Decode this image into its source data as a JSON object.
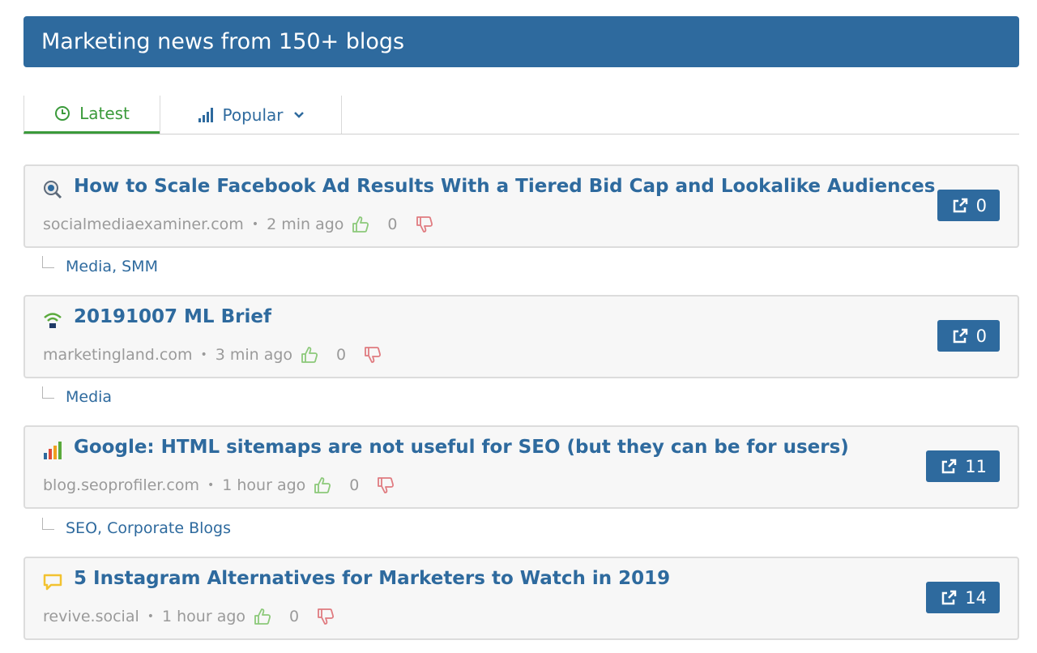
{
  "header": {
    "title": "Marketing news from 150+ blogs"
  },
  "tabs": {
    "latest": "Latest",
    "popular": "Popular"
  },
  "posts": [
    {
      "title": "How to Scale Facebook Ad Results With a Tiered Bid Cap and Lookalike Audiences",
      "source": "socialmediaexaminer.com",
      "time": "2 min ago",
      "votes": "0",
      "shares": "0",
      "tags": [
        "Media",
        "SMM"
      ],
      "icon": "magnifier-icon"
    },
    {
      "title": "20191007 ML Brief",
      "source": "marketingland.com",
      "time": "3 min ago",
      "votes": "0",
      "shares": "0",
      "tags": [
        "Media"
      ],
      "icon": "wifi-icon"
    },
    {
      "title": "Google: HTML sitemaps are not useful for SEO (but they can be for users)",
      "source": "blog.seoprofiler.com",
      "time": "1 hour ago",
      "votes": "0",
      "shares": "11",
      "tags": [
        "SEO",
        "Corporate Blogs"
      ],
      "icon": "bar-chart-icon"
    },
    {
      "title": "5 Instagram Alternatives for Marketers to Watch in 2019",
      "source": "revive.social",
      "time": "1 hour ago",
      "votes": "0",
      "shares": "14",
      "tags": [],
      "icon": "chat-bubble-icon"
    }
  ],
  "colors": {
    "brand": "#2e6a9e",
    "active_tab": "#3a9a3a",
    "upvote": "#8cc97a",
    "downvote": "#e07b80"
  }
}
